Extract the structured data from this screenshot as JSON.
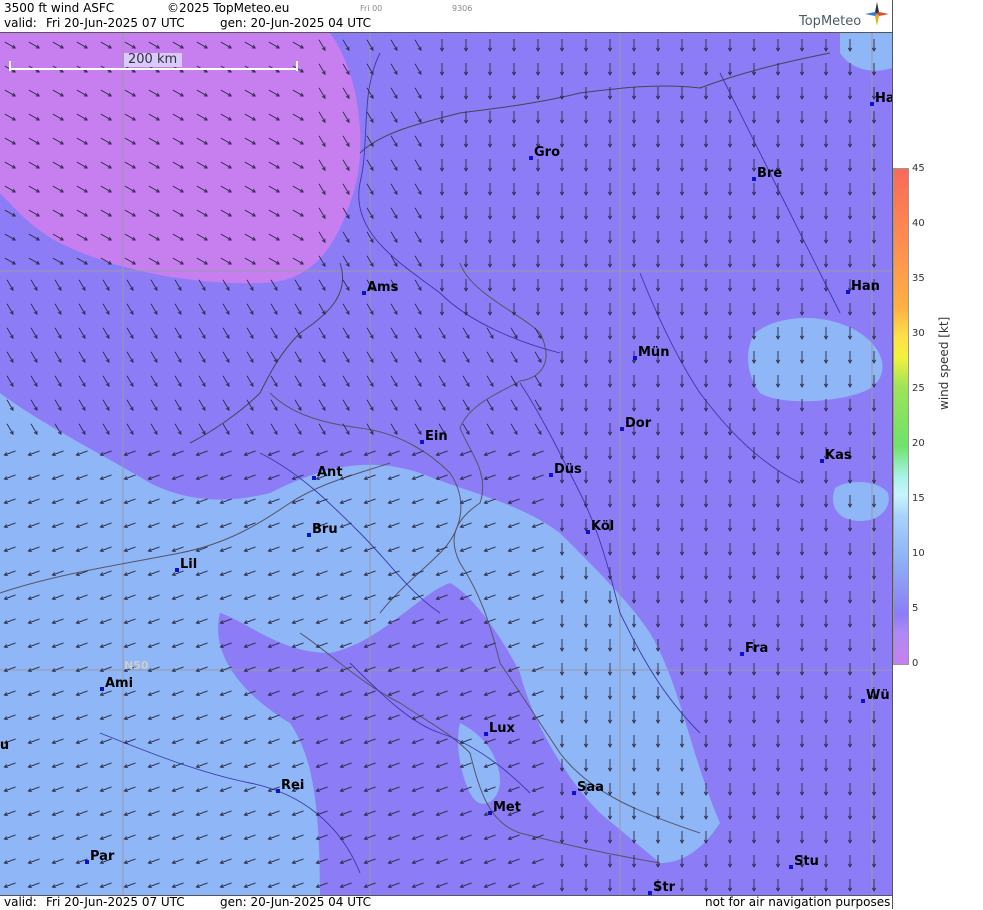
{
  "header": {
    "title": "3500 ft wind ASFC",
    "copyright": "©2025 TopMeteo.eu",
    "small1": "Fri 00",
    "small2": "9306",
    "valid_label": "valid:",
    "valid_time": "Fri  20-Jun-2025  07 UTC",
    "gen_time": "gen: 20-Jun-2025 04 UTC",
    "logo_text": "TopMeteo"
  },
  "scale": {
    "label": "200 km"
  },
  "grid_label": "N50",
  "cities": [
    {
      "name": "Gro"
    },
    {
      "name": "Bre"
    },
    {
      "name": "Ha"
    },
    {
      "name": "Ams"
    },
    {
      "name": "Han"
    },
    {
      "name": "Mün"
    },
    {
      "name": "Ein"
    },
    {
      "name": "Dor"
    },
    {
      "name": "Kas"
    },
    {
      "name": "Ant"
    },
    {
      "name": "Düs"
    },
    {
      "name": "Bru"
    },
    {
      "name": "Köl"
    },
    {
      "name": "Lil"
    },
    {
      "name": "Fra"
    },
    {
      "name": "Ami"
    },
    {
      "name": "Wü"
    },
    {
      "name": "Lux"
    },
    {
      "name": "ou"
    },
    {
      "name": "Rei"
    },
    {
      "name": "Saa"
    },
    {
      "name": "Met"
    },
    {
      "name": "Par"
    },
    {
      "name": "Stu"
    },
    {
      "name": "Str"
    }
  ],
  "colorbar": {
    "label": "wind  speed  [kt]",
    "ticks": [
      "45",
      "40",
      "35",
      "30",
      "25",
      "20",
      "15",
      "10",
      "5",
      "0"
    ],
    "colors": {
      "c0": "#c77ff0",
      "c5": "#8c7cf6",
      "c10": "#8fb6f6",
      "c15": "#c9f4fb",
      "c20": "#6fe26b",
      "c30": "#f2f23d",
      "c35": "#ffb045",
      "c45": "#f86a58"
    }
  },
  "footer": {
    "valid_label": "valid:",
    "valid_time": "Fri  20-Jun-2025  07 UTC",
    "gen_time": "gen: 20-Jun-2025 04 UTC",
    "disclaimer": "not for air navigation purposes"
  }
}
